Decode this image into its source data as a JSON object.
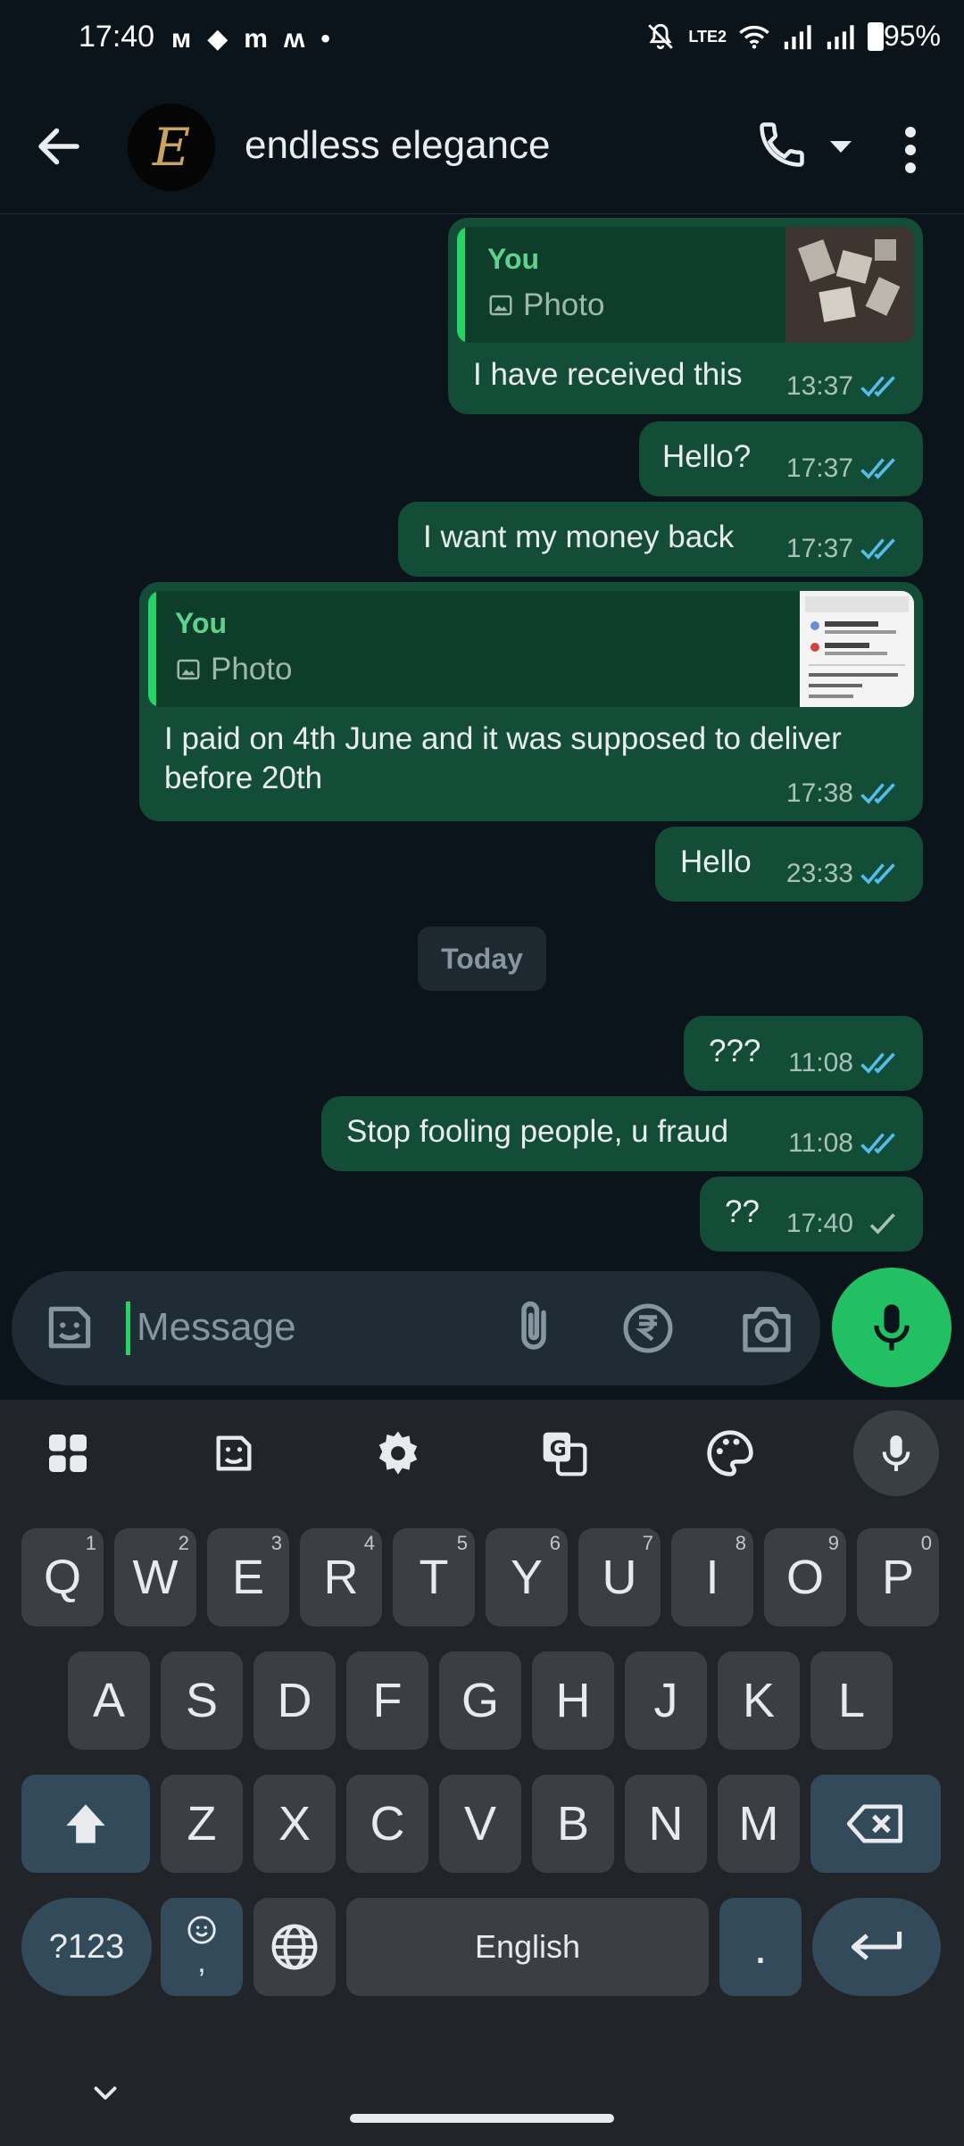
{
  "status_bar": {
    "time": "17:40",
    "battery": "95%",
    "network": "LTE2"
  },
  "header": {
    "contact_name": "endless elegance",
    "avatar_letter": "E"
  },
  "messages": [
    {
      "quote_author": "You",
      "quote_type": "Photo",
      "text": "I have received this",
      "time": "13:37",
      "status": "read"
    },
    {
      "text": "Hello?",
      "time": "17:37",
      "status": "read"
    },
    {
      "text": "I want my money back",
      "time": "17:37",
      "status": "read"
    },
    {
      "quote_author": "You",
      "quote_type": "Photo",
      "text_line1": "I paid on 4th June and it was supposed to deliver",
      "text_line2": "before 20th",
      "time": "17:38",
      "status": "read"
    },
    {
      "text": "Hello",
      "time": "23:33",
      "status": "read"
    },
    {
      "text": "???",
      "time": "11:08",
      "status": "read"
    },
    {
      "text": "Stop fooling people, u fraud",
      "time": "11:08",
      "status": "read"
    },
    {
      "text": "??",
      "time": "17:40",
      "status": "sent"
    }
  ],
  "day_divider": "Today",
  "composer": {
    "placeholder": "Message"
  },
  "keyboard": {
    "row1": [
      "Q",
      "W",
      "E",
      "R",
      "T",
      "Y",
      "U",
      "I",
      "O",
      "P"
    ],
    "row1_sup": [
      "1",
      "2",
      "3",
      "4",
      "5",
      "6",
      "7",
      "8",
      "9",
      "0"
    ],
    "row2": [
      "A",
      "S",
      "D",
      "F",
      "G",
      "H",
      "J",
      "K",
      "L"
    ],
    "row3": [
      "Z",
      "X",
      "C",
      "V",
      "B",
      "N",
      "M"
    ],
    "symbols_label": "?123",
    "comma_label": ",",
    "space_label": "English",
    "period_label": "."
  },
  "colors": {
    "background": "#0b141a",
    "bubble_out": "#144d37",
    "accent_green": "#21c063",
    "read_tick": "#53bdeb"
  }
}
